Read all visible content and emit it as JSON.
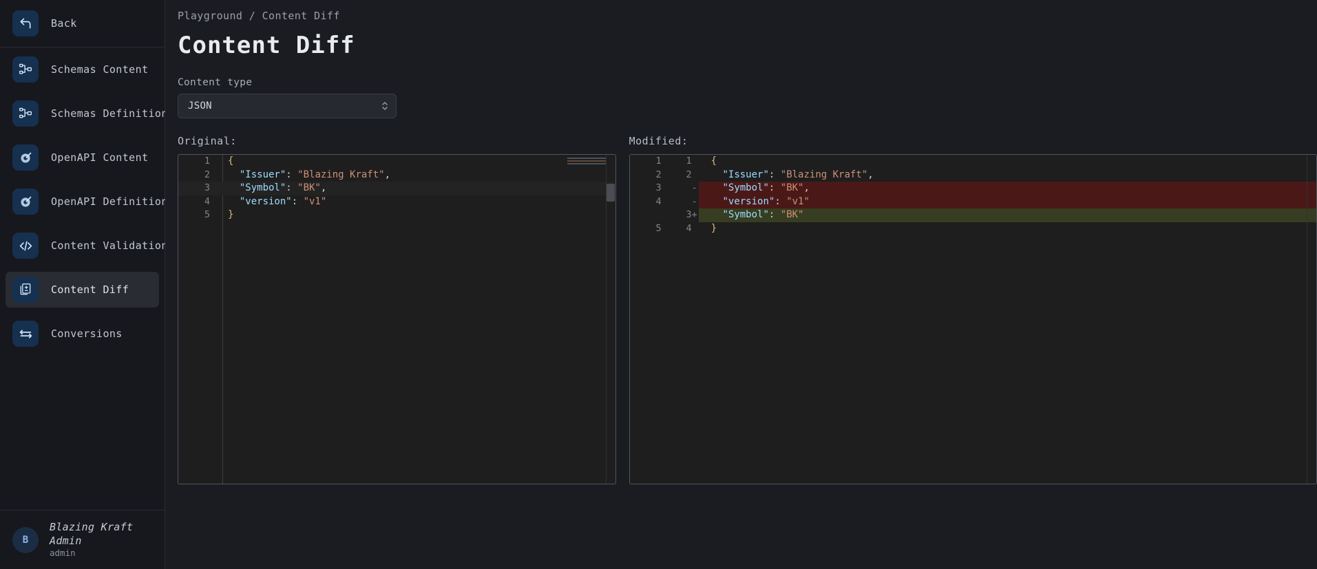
{
  "sidebar": {
    "back": {
      "label": "Back",
      "icon": "back-arrow-icon"
    },
    "items": [
      {
        "label": "Schemas Content",
        "icon": "schema-icon",
        "active": false
      },
      {
        "label": "Schemas Definition",
        "icon": "schema-icon",
        "active": false
      },
      {
        "label": "OpenAPI Content",
        "icon": "openapi-icon",
        "active": false
      },
      {
        "label": "OpenAPI Definition",
        "icon": "openapi-icon",
        "active": false
      },
      {
        "label": "Content Validation",
        "icon": "code-icon",
        "active": false
      },
      {
        "label": "Content Diff",
        "icon": "diff-file-icon",
        "active": true
      },
      {
        "label": "Conversions",
        "icon": "conversions-icon",
        "active": false
      }
    ],
    "user": {
      "avatar_initial": "B",
      "name": "Blazing Kraft Admin",
      "role": "admin"
    }
  },
  "header": {
    "breadcrumb": "Playground / Content Diff",
    "title": "Content Diff"
  },
  "form": {
    "content_type_label": "Content type",
    "content_type_value": "JSON",
    "content_type_options": [
      "JSON"
    ]
  },
  "editors": {
    "original_label": "Original:",
    "modified_label": "Modified:",
    "original_lines": [
      {
        "no": "1",
        "current": false,
        "tokens": [
          {
            "t": "{",
            "c": "br"
          }
        ]
      },
      {
        "no": "2",
        "current": false,
        "tokens": [
          {
            "t": "  ",
            "c": "p"
          },
          {
            "t": "\"Issuer\"",
            "c": "k"
          },
          {
            "t": ": ",
            "c": "p"
          },
          {
            "t": "\"Blazing Kraft\"",
            "c": "s"
          },
          {
            "t": ",",
            "c": "p"
          }
        ]
      },
      {
        "no": "3",
        "current": true,
        "tokens": [
          {
            "t": "  ",
            "c": "p"
          },
          {
            "t": "\"Symbol\"",
            "c": "k"
          },
          {
            "t": ": ",
            "c": "p"
          },
          {
            "t": "\"BK\"",
            "c": "s"
          },
          {
            "t": ",",
            "c": "p"
          }
        ]
      },
      {
        "no": "4",
        "current": false,
        "tokens": [
          {
            "t": "  ",
            "c": "p"
          },
          {
            "t": "\"version\"",
            "c": "k"
          },
          {
            "t": ": ",
            "c": "p"
          },
          {
            "t": "\"v1\"",
            "c": "s"
          }
        ]
      },
      {
        "no": "5",
        "current": false,
        "tokens": [
          {
            "t": "}",
            "c": "br"
          }
        ]
      }
    ],
    "modified_lines": [
      {
        "left_no": "1",
        "right_no": "1",
        "sign": "",
        "state": "same",
        "tokens": [
          {
            "t": "{",
            "c": "br"
          }
        ]
      },
      {
        "left_no": "2",
        "right_no": "2",
        "sign": "",
        "state": "same",
        "tokens": [
          {
            "t": "  ",
            "c": "p"
          },
          {
            "t": "\"Issuer\"",
            "c": "k"
          },
          {
            "t": ": ",
            "c": "p"
          },
          {
            "t": "\"Blazing Kraft\"",
            "c": "s"
          },
          {
            "t": ",",
            "c": "p"
          }
        ]
      },
      {
        "left_no": "3",
        "right_no": "",
        "sign": "-",
        "state": "deleted",
        "tokens": [
          {
            "t": "  ",
            "c": "p"
          },
          {
            "t": "\"Symbol\"",
            "c": "k"
          },
          {
            "t": ": ",
            "c": "p"
          },
          {
            "t": "\"BK\"",
            "c": "s"
          },
          {
            "t": ",",
            "c": "p"
          }
        ]
      },
      {
        "left_no": "4",
        "right_no": "",
        "sign": "-",
        "state": "deleted",
        "tokens": [
          {
            "t": "  ",
            "c": "p"
          },
          {
            "t": "\"version\"",
            "c": "k"
          },
          {
            "t": ": ",
            "c": "p"
          },
          {
            "t": "\"v1\"",
            "c": "s"
          }
        ]
      },
      {
        "left_no": "",
        "right_no": "3",
        "sign": "+",
        "state": "added",
        "tokens": [
          {
            "t": "  ",
            "c": "p"
          },
          {
            "t": "\"Symbol\"",
            "c": "k"
          },
          {
            "t": ": ",
            "c": "p"
          },
          {
            "t": "\"BK\"",
            "c": "s"
          }
        ]
      },
      {
        "left_no": "5",
        "right_no": "4",
        "sign": "",
        "state": "same",
        "tokens": [
          {
            "t": "}",
            "c": "br"
          }
        ]
      }
    ]
  },
  "colors": {
    "accent": "#16304f",
    "sidebar_bg": "#16181d",
    "main_bg": "#1a1c22",
    "editor_bg": "#1e1e1e",
    "diff_deleted": "#4b1818",
    "diff_added": "#373d21",
    "key": "#9cdcfe",
    "string": "#ce9178",
    "brace": "#d7ba7d"
  }
}
